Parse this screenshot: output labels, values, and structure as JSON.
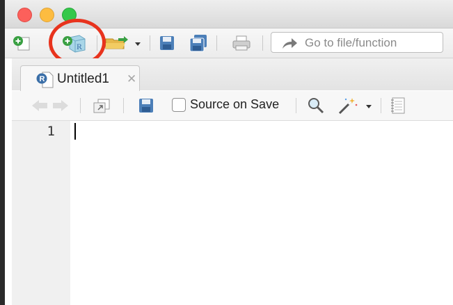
{
  "window": {
    "controls": [
      "close",
      "minimize",
      "maximize"
    ]
  },
  "toolbar": {
    "buttons": [
      {
        "name": "new-file",
        "icon": "plus-circle-icon"
      },
      {
        "name": "new-project",
        "icon": "r-project-plus-icon",
        "highlighted": true
      },
      {
        "name": "open-file",
        "icon": "folder-open-icon"
      },
      {
        "name": "save",
        "icon": "save-icon"
      },
      {
        "name": "save-all",
        "icon": "save-all-icon"
      },
      {
        "name": "print",
        "icon": "print-icon"
      }
    ],
    "goto_placeholder": "Go to file/function"
  },
  "tabs": [
    {
      "label": "Untitled1",
      "icon": "r-file-icon",
      "active": true
    }
  ],
  "editor_toolbar": {
    "source_on_save_label": "Source on Save",
    "source_on_save_checked": false
  },
  "editor": {
    "line_numbers": [
      "1"
    ],
    "content": ""
  },
  "colors": {
    "annotation_circle": "#e8331d",
    "close": "#fc605b",
    "minimize": "#fdbc40",
    "maximize": "#34c84a"
  }
}
